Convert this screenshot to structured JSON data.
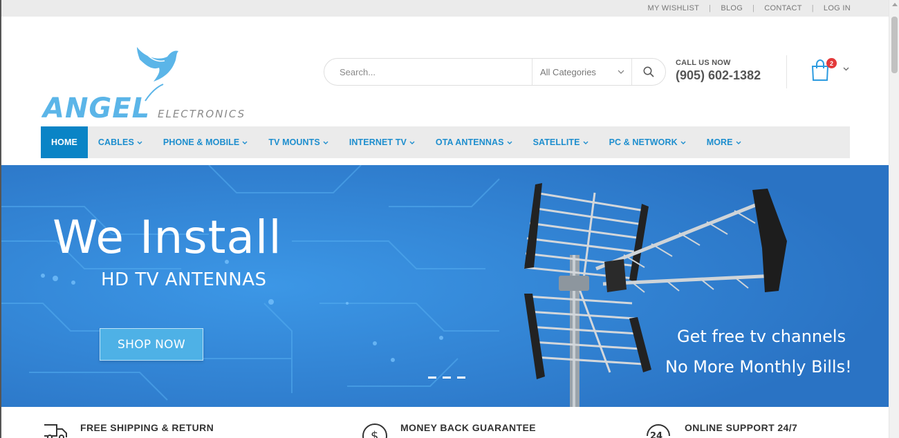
{
  "topbar": {
    "links": [
      "MY WISHLIST",
      "BLOG",
      "CONTACT",
      "LOG IN"
    ]
  },
  "logo": {
    "brand": "ANGEL",
    "sub": "ELECTRONICS",
    "icon": "angel-bird-icon",
    "color": "#5bb5e8"
  },
  "search": {
    "placeholder": "Search...",
    "category": "All Categories",
    "icon": "search-icon"
  },
  "contact": {
    "label": "CALL US NOW",
    "phone": "(905) 602-1382"
  },
  "cart": {
    "count": "2",
    "icon": "shopping-bag-icon"
  },
  "nav": {
    "items": [
      {
        "label": "HOME",
        "active": true
      },
      {
        "label": "CABLES"
      },
      {
        "label": "PHONE & MOBILE"
      },
      {
        "label": "TV MOUNTS"
      },
      {
        "label": "INTERNET TV"
      },
      {
        "label": "OTA ANTENNAS"
      },
      {
        "label": "SATELLITE"
      },
      {
        "label": "PC & NETWORK"
      },
      {
        "label": "MORE"
      }
    ]
  },
  "hero": {
    "title": "We Install",
    "subtitle": "HD TV ANTENNAS",
    "cta": "SHOP NOW",
    "tagline1": "Get free tv channels",
    "tagline2": "No More Monthly Bills!",
    "slide_count": 3
  },
  "features": [
    {
      "title": "FREE SHIPPING & RETURN",
      "icon": "truck-icon"
    },
    {
      "title": "MONEY BACK GUARANTEE",
      "icon": "dollar-icon"
    },
    {
      "title": "ONLINE SUPPORT 24/7",
      "icon": "support-24-icon"
    }
  ],
  "colors": {
    "accent": "#0a84c6",
    "nav_text": "#1d8ece",
    "hero_bg": "#2d7fd0",
    "badge": "#e3393a"
  }
}
